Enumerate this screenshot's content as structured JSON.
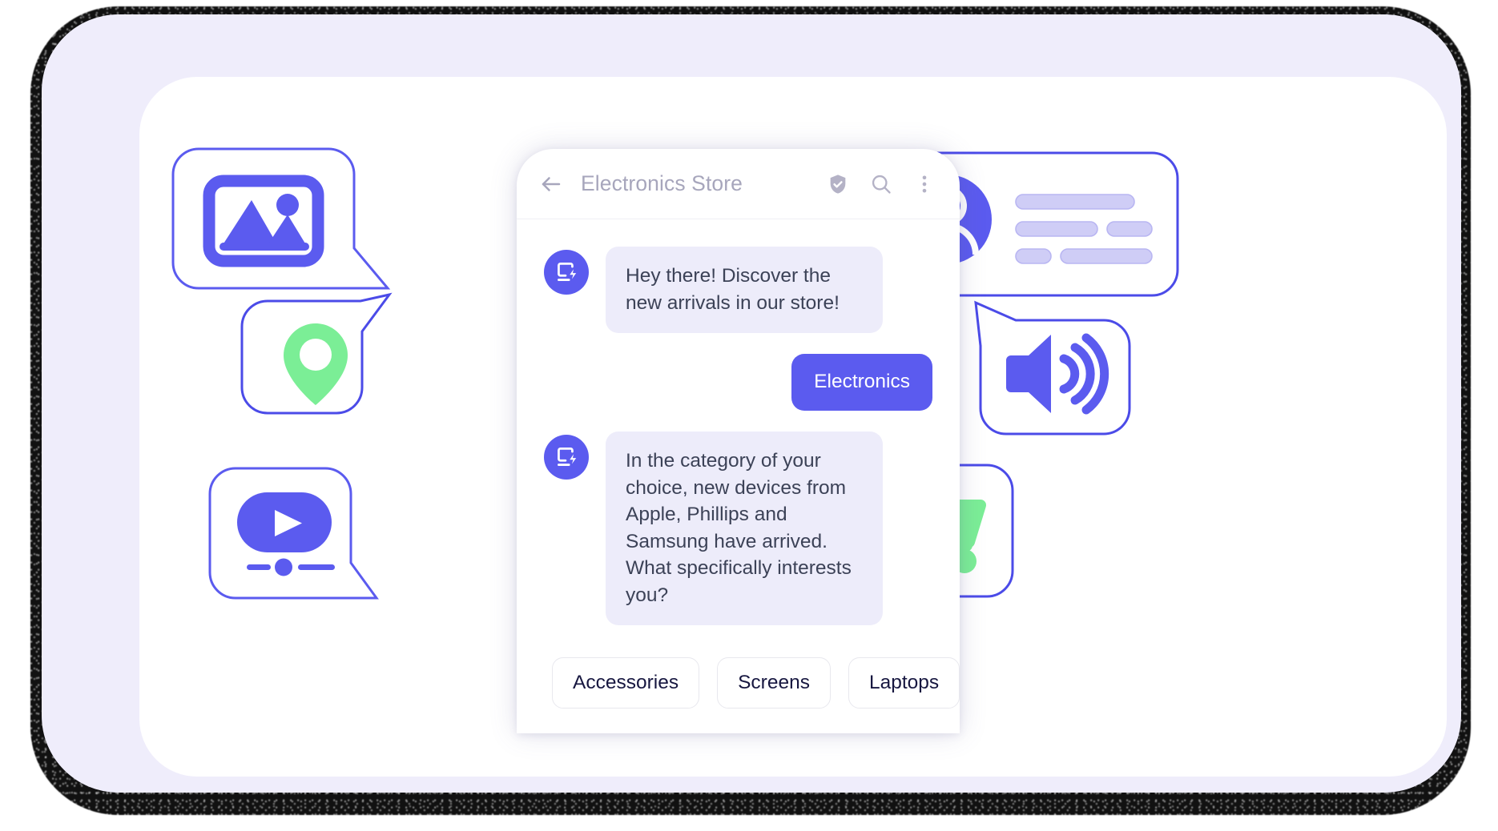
{
  "app": {
    "background_color": "#FFFFFF",
    "outer_card_color": "#EFEDFB",
    "inner_card_color": "#FFFFFF",
    "accent_color": "#5B5BEF",
    "accent_green": "#7BEE96",
    "bot_bubble_color": "#EDECFA",
    "bot_text_color": "#3C4257",
    "muted_color": "#A7A6BC"
  },
  "phone": {
    "header": {
      "back_icon": "arrow-left-icon",
      "title": "Electronics Store",
      "actions": [
        {
          "icon": "shield-check-icon",
          "label": "Verified business"
        },
        {
          "icon": "search-icon",
          "label": "Search"
        },
        {
          "icon": "more-vertical-icon",
          "label": "More options"
        }
      ]
    },
    "messages": [
      {
        "id": "msg-1",
        "from": "bot",
        "avatar_icon": "device-bolt-icon",
        "text": "Hey there! Discover the new arrivals in our store!"
      },
      {
        "id": "msg-2",
        "from": "user",
        "text": "Electronics"
      },
      {
        "id": "msg-3",
        "from": "bot",
        "avatar_icon": "device-bolt-icon",
        "text": "In the category of your choice, new devices from Apple, Phillips and Samsung have arrived. What specifically interests you?"
      }
    ],
    "quick_replies": [
      {
        "id": "chip-accessories",
        "label": "Accessories"
      },
      {
        "id": "chip-screens",
        "label": "Screens"
      },
      {
        "id": "chip-laptops",
        "label": "Laptops"
      }
    ]
  },
  "decorations": {
    "left": [
      {
        "id": "image-bubble",
        "icon": "image-icon",
        "color": "#5B5BEF",
        "tail": "bottom-right"
      },
      {
        "id": "location-bubble",
        "icon": "location-pin-icon",
        "color": "#7BEE96",
        "tail": "top-right"
      },
      {
        "id": "video-bubble",
        "icon": "video-play-icon",
        "color": "#5B5BEF",
        "tail": "bottom-right"
      }
    ],
    "right": [
      {
        "id": "profile-bubble",
        "icon": "user-avatar-icon",
        "color": "#5B5BEF",
        "tail": "bottom-left",
        "placeholder_rows": 3
      },
      {
        "id": "sound-bubble",
        "icon": "speaker-waves-icon",
        "color": "#5B5BEF",
        "tail": "top-left"
      },
      {
        "id": "cart-bubble",
        "icon": "shopping-cart-icon",
        "color": "#7BEE96",
        "tail": "bottom-left"
      }
    ]
  }
}
